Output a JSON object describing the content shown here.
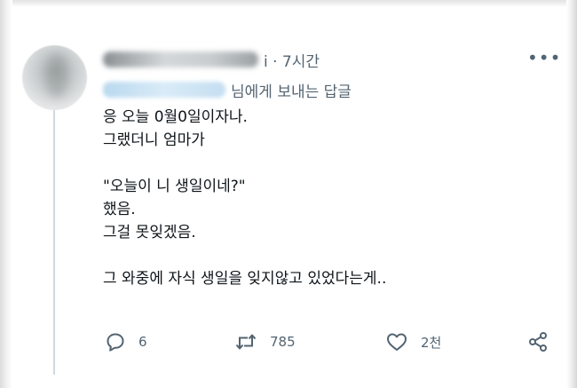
{
  "tweet": {
    "header_tail": "i · 7시간",
    "more_icon": "•••",
    "reply_tail": "님에게 보내는 답글",
    "lines": [
      "응 오늘 0월0일이자나.",
      "그랬더니 엄마가",
      "",
      "\"오늘이 니 생일이네?\"",
      "했음.",
      "그걸 못잊겠음.",
      "",
      "그 와중에 자식 생일을 잊지않고 있었다는게.."
    ],
    "actions": {
      "replies": "6",
      "retweets": "785",
      "likes": "2천"
    }
  },
  "icons": [
    "reply-icon",
    "retweet-icon",
    "like-icon",
    "share-icon",
    "more-icon"
  ]
}
